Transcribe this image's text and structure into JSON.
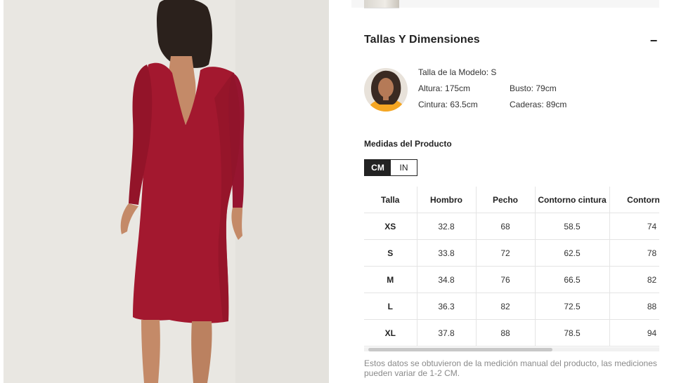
{
  "product_image": {
    "alt": ""
  },
  "size_section": {
    "title": "Tallas Y Dimensiones",
    "collapse_symbol": "−"
  },
  "model": {
    "talla_label": "Talla de la Modelo: S",
    "altura_label": "Altura: 175cm",
    "busto_label": "Busto: 79cm",
    "cintura_label": "Cintura: 63.5cm",
    "caderas_label": "Caderas: 89cm"
  },
  "measures": {
    "title": "Medidas del Producto",
    "units": [
      "CM",
      "IN"
    ],
    "active_unit": "CM"
  },
  "size_table": {
    "headers": [
      "Talla",
      "Hombro",
      "Pecho",
      "Contorno cintura",
      "Contorno ca"
    ],
    "rows": [
      [
        "XS",
        "32.8",
        "68",
        "58.5",
        "74"
      ],
      [
        "S",
        "33.8",
        "72",
        "62.5",
        "78"
      ],
      [
        "M",
        "34.8",
        "76",
        "66.5",
        "82"
      ],
      [
        "L",
        "36.3",
        "82",
        "72.5",
        "88"
      ],
      [
        "XL",
        "37.8",
        "88",
        "78.5",
        "94"
      ]
    ]
  },
  "disclaimer": "Estos datos se obtuvieron de la medición manual del producto, las mediciones pueden variar de 1-2 CM.",
  "colors": {
    "dress": "#a3182f",
    "active_toggle": "#222222",
    "border": "#e4e4e4"
  }
}
